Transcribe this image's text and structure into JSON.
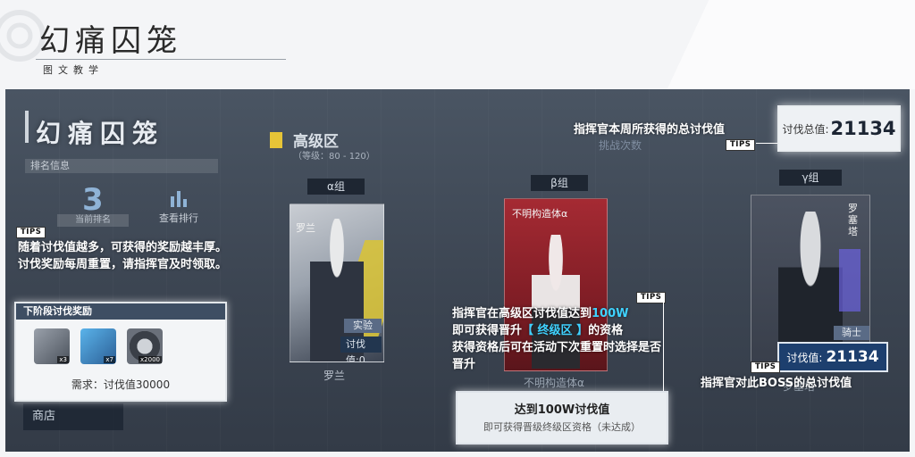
{
  "header": {
    "title": "幻痛囚笼",
    "subtitle": "图文教学"
  },
  "game": {
    "title": "幻痛囚笼",
    "rank_info_label": "排名信息",
    "rank_number": "3",
    "rank_label": "当前排名",
    "view_ranking_label": "查看排行",
    "shop_label": "商店",
    "zone_title": "高级区",
    "zone_level": "（等级：80 - 120）",
    "challenge_count_label": "挑战次数",
    "groups": [
      {
        "label": "α组",
        "char_name_vertical": "罗兰",
        "tag": "实验",
        "score_label": "讨伐值:",
        "score": "0",
        "name": "罗兰"
      },
      {
        "label": "β组",
        "char_name": "不明构造体α",
        "name": "不明构造体α"
      },
      {
        "label": "γ组",
        "char_name_vertical": "罗塞塔",
        "tag": "骑士",
        "name": "罗塞塔"
      }
    ]
  },
  "tips_label": "TIPS",
  "annotations": {
    "reward_tip": "随着讨伐值越多，可获得的奖励越丰厚。讨伐奖励每周重置，请指挥官及时领取。",
    "total_tip": "指挥官本周所获得的总讨伐值",
    "boss_tip": "指挥官对此BOSS的总讨伐值",
    "promote_line1_a": "指挥官在高级区讨伐值达到",
    "promote_line1_hl": "100W",
    "promote_line2_a": "即可获得晋升",
    "promote_line2_hl": "【 终级区 】",
    "promote_line2_b": "的资格",
    "promote_line3": "获得资格后可在活动下次重置时选择是否晋升"
  },
  "reward_box": {
    "title": "下阶段讨伐奖励",
    "items": [
      {
        "icon": "weapon-chip-icon",
        "count": "x3"
      },
      {
        "icon": "blue-material-icon",
        "count": "x7"
      },
      {
        "icon": "ring-material-icon",
        "count": "x2000"
      }
    ],
    "requirement": "需求：讨伐值30000"
  },
  "total_box": {
    "label": "讨伐总值:",
    "value": "21134"
  },
  "boss_box": {
    "label": "讨伐值:",
    "value": "21134"
  },
  "goal_box": {
    "line1": "达到100W讨伐值",
    "line2": "即可获得晋级终级区资格（未达成）"
  },
  "colors": {
    "highlight": "#3fd2ff",
    "zone_flag": "#e6c437",
    "boss_box_bg": "#1d3f6e",
    "reward_head_bg": "#3e4e63"
  }
}
